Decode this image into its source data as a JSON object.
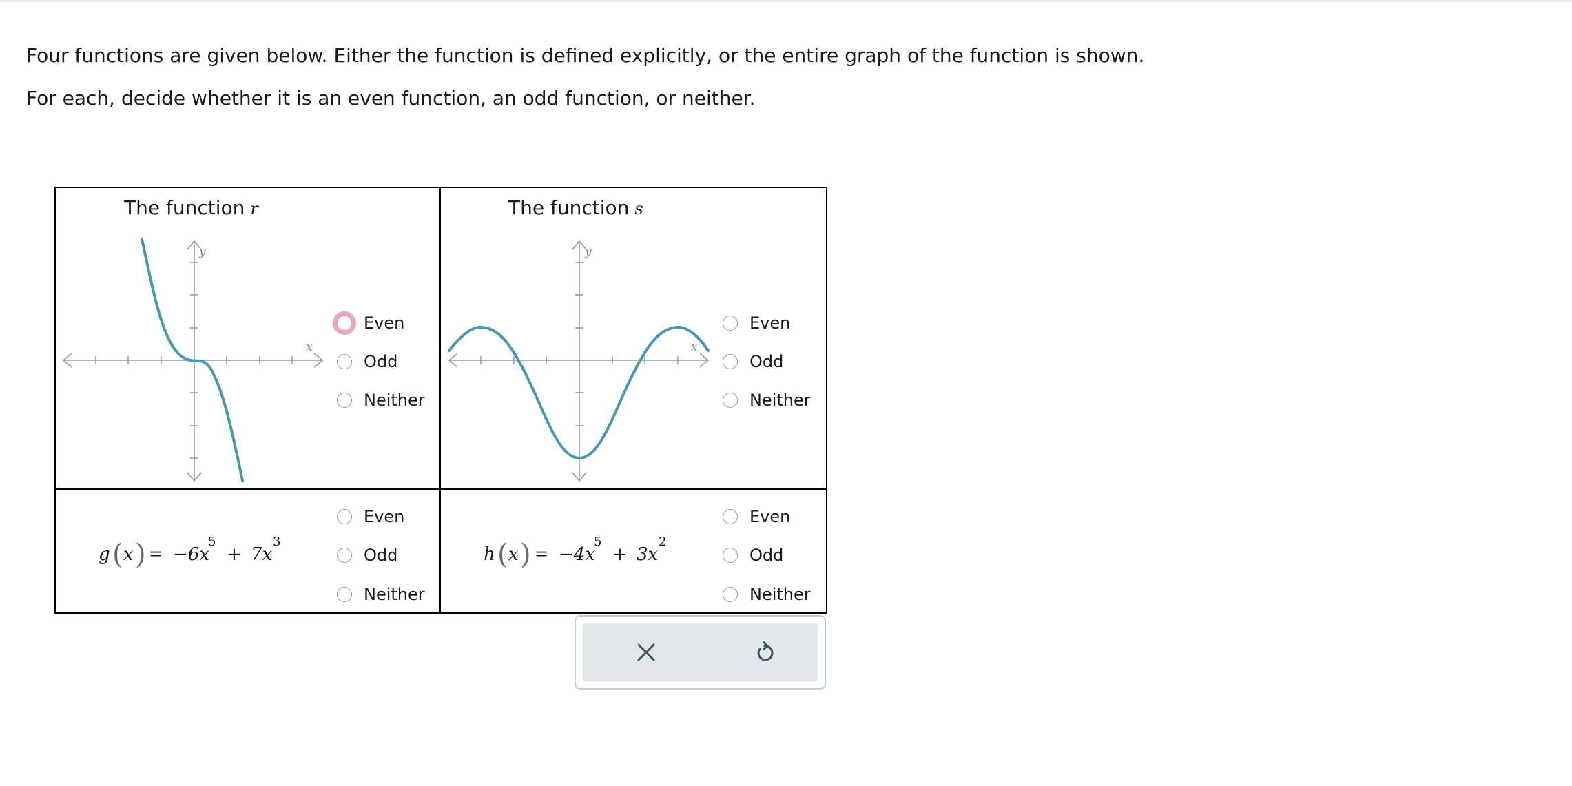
{
  "instructions": {
    "line1": "Four functions are given below. Either the function is defined explicitly, or the entire graph of the function is shown.",
    "line2": "For each, decide whether it is an even function, an odd function, or neither."
  },
  "cells": {
    "r": {
      "title": "The function",
      "var": "r",
      "x_label": "x",
      "y_label": "y",
      "curve_color": "#4a98ab",
      "options": [
        "Even",
        "Odd",
        "Neither"
      ],
      "focused_option": "Even"
    },
    "s": {
      "title": "The function",
      "var": "s",
      "x_label": "x",
      "y_label": "y",
      "curve_color": "#4a98ab",
      "options": [
        "Even",
        "Odd",
        "Neither"
      ]
    },
    "g": {
      "fname": "g",
      "var": "x",
      "equals": "=",
      "term1": "−6x",
      "exp1": "5",
      "plus": "+",
      "term2": "7x",
      "exp2": "3",
      "options": [
        "Even",
        "Odd",
        "Neither"
      ]
    },
    "h": {
      "fname": "h",
      "var": "x",
      "equals": "=",
      "term1": "−4x",
      "exp1": "5",
      "plus": "+",
      "term2": "3x",
      "exp2": "2",
      "options": [
        "Even",
        "Odd",
        "Neither"
      ]
    }
  },
  "toolbar": {
    "clear_icon": "close-icon",
    "undo_icon": "undo-icon",
    "icon_color": "#3d5560"
  },
  "colors": {
    "axis": "#8a9aa3",
    "focus_ring": "#e6a8c0",
    "grid_border": "#000000"
  }
}
